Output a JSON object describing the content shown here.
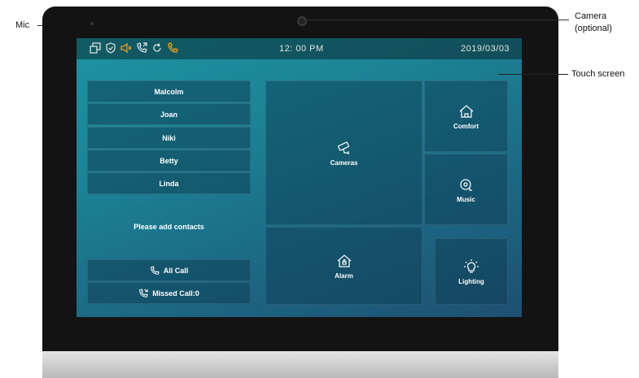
{
  "annotations": {
    "mic": "Mic",
    "camera_line1": "Camera",
    "camera_line2": "(optional)",
    "touch_screen": "Touch screen"
  },
  "statusbar": {
    "time": "12: 00 PM",
    "date": "2019/03/03",
    "icons": [
      "window-icon",
      "shield-icon",
      "mute-icon",
      "call-forward-icon",
      "redial-icon",
      "phone-icon"
    ],
    "accent": "#f0a020"
  },
  "contacts": [
    "Malcolm",
    "Joan",
    "Niki",
    "Betty",
    "Linda"
  ],
  "add_contacts": "Please add contacts",
  "calls": {
    "all_call": "All Call",
    "missed_call": "Missed Call:0"
  },
  "tiles": {
    "cameras": "Cameras",
    "comfort": "Comfort",
    "music": "Music",
    "alarm": "Alarm",
    "lighting": "Lighting"
  }
}
